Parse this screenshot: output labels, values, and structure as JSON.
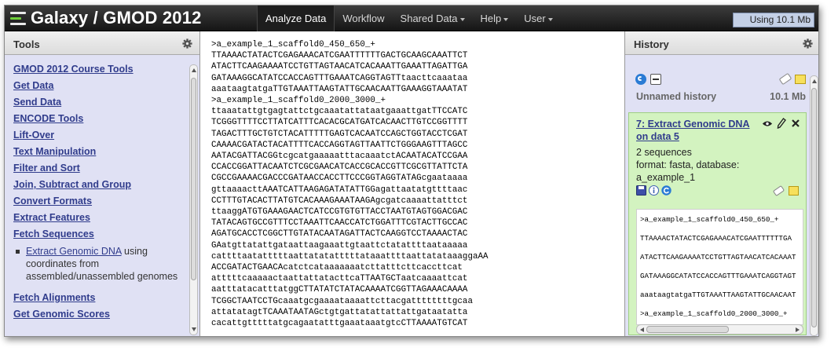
{
  "masthead": {
    "brand": "Galaxy / GMOD 2012",
    "nav": [
      {
        "label": "Analyze Data",
        "active": true,
        "dropdown": false
      },
      {
        "label": "Workflow",
        "active": false,
        "dropdown": false
      },
      {
        "label": "Shared Data",
        "active": false,
        "dropdown": true
      },
      {
        "label": "Help",
        "active": false,
        "dropdown": true
      },
      {
        "label": "User",
        "active": false,
        "dropdown": true
      }
    ],
    "usage": "Using 10.1 Mb"
  },
  "tools": {
    "title": "Tools",
    "sections": [
      "GMOD 2012 Course Tools",
      "Get Data",
      "Send Data",
      "ENCODE Tools",
      "Lift-Over",
      "Text Manipulation",
      "Filter and Sort",
      "Join, Subtract and Group",
      "Convert Formats",
      "Extract Features",
      "Fetch Sequences"
    ],
    "expanded_item": {
      "link": "Extract Genomic DNA",
      "rest": " using coordinates from assembled/unassembled genomes"
    },
    "more_sections": [
      "Fetch Alignments",
      "Get Genomic Scores"
    ]
  },
  "sequence": {
    "lines": [
      ">a_example_1_scaffold0_450_650_+",
      "TTAAAACTATACTCGAGAAACATCGAATTTTTTGACTGCAAGCAAATTCT",
      "ATACTTCAAGAAAATCCTGTTAGTAACATCACAAATTGAAATTAGATTGA",
      "GATAAAGGCATATCCACCAGTTTGAAATCAGGTAGTTtaacttcaaataa",
      "aaataagtatgaTTGTAAATTAAGTATTGCAACAATTGAAAGGTAAATAT",
      ">a_example_1_scaffold0_2000_3000_+",
      "ttaaatattgtgagtattctgcaaatattataatgaaattgatTTCCATC",
      "TCGGGTTTTCCTTATCATTTCACACGCATGATCACAACTTGTCCGGTTTT",
      "TAGACTTTGCTGTCTACATTTTTGAGTCACAATCCAGCTGGTACCTCGAT",
      "CAAAACGATACTACATTTTCACCAGGTAGTTAATTCTGGGAAGTTTAGCC",
      "AATACGATTACGGtcgcatgaaaaatttacaaatctACAATACATCCGAA",
      "CCACCGGATTACAATCTCGCGAACATCACCGCACCGTTCGCGTTATTCTA",
      "CGCCGAAAACGACCCGATAACCACCTTCCCGGTAGGTATAGcgaataaaa",
      "gttaaaacttAAATCATTAAGAGATATATTGGagattaatatgttttaac",
      "CCTTTGTACACTTATGTCACAAAGAAATAAGAgcgatcaaaattatttct",
      "ttaaggATGTGAAAGAACTCATCCGTGTGTTACCTAATGTAGTGGACGAC",
      "TATACAGTGCCGTTTCCTAAATTCAACCATCTGGATTTCGTACTTGCCAC",
      "AGATGCACCTCGGCTTGTATACAATAGATTACTCAAGGTCCTAAAACTAC",
      "GAatgttatattgataattaagaaattgtaattctatattttaataaaaa",
      "cattttaatatttttaattatatatttttataaattttaattatataaaggaAA",
      "ACCGATACTGAACAcatctcataaaaaaatcttatttcttcaccttcat",
      "atttttcaaaaactaattattatacttcaTTAATGCTaatcaaaattcat",
      "aatttatacatttatggCTTATATCTATACAAAATCGGTTAGAAACAAAA",
      "TCGGCTAATCCTGcaaatgcgaaaataaaattcttacgattttttttgcaa",
      "attatatagtTCAAATAATAGctgtgattatattattattgataatatta",
      "cacattgtttttatgcagaatatttgaaataaatgtcCTTAAAATGTCAT"
    ]
  },
  "history": {
    "title": "History",
    "name": "Unnamed history",
    "size": "10.1 Mb",
    "dataset": {
      "title": "7: Extract Genomic DNA on data 5",
      "info_lines": [
        "2 sequences",
        "format: fasta, database:",
        "a_example_1"
      ],
      "peek": [
        ">a_example_1_scaffold0_450_650_+",
        "TTAAAACTATACTCGAGAAACATCGAATTTTTTGA",
        "ATACTTCAAGAAAATCCTGTTAGTAACATCACAAAT",
        "GATAAAGGCATATCCACCAGTTTGAAATCAGGTAGT",
        "aaataagtatgaTTGTAAATTAAGTATTGCAACAAT",
        ">a_example_1_scaffold0_2000_3000_+"
      ]
    }
  }
}
